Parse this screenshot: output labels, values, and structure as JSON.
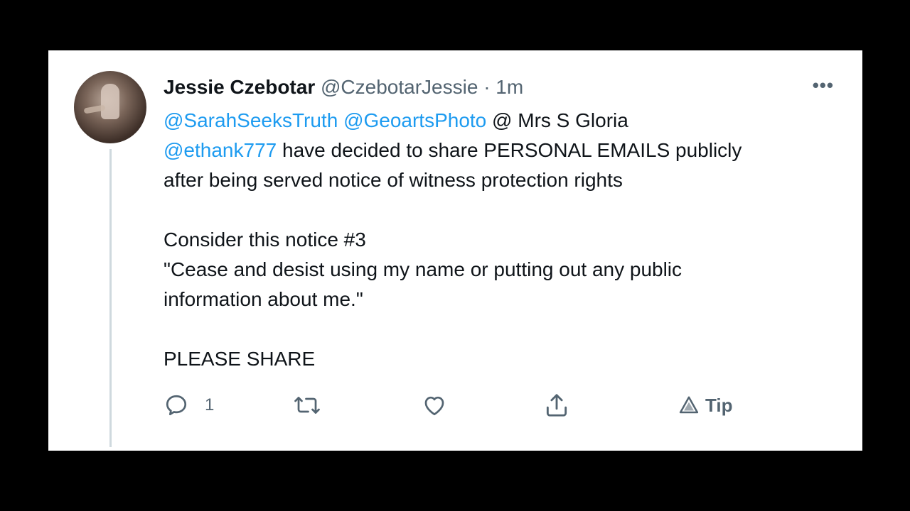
{
  "tweet": {
    "author_name": "Jessie Czebotar",
    "author_handle": "@CzebotarJessie",
    "separator": "·",
    "time": "1m",
    "more_label": "•••",
    "line1": {
      "mention1": "@SarahSeeksTruth",
      "mention2": "@GeoartsPhoto",
      "rest": " @ Mrs S Gloria"
    },
    "line2": {
      "mention": "@ethank777",
      "rest": " have decided to share PERSONAL EMAILS publicly"
    },
    "line3": "after being served notice of witness protection rights",
    "line4": "Consider this notice #3",
    "line5": "\"Cease and desist using my name or putting out any public",
    "line6": "information about me.\"",
    "line7": "PLEASE SHARE"
  },
  "actions": {
    "reply_count": "1",
    "tip_label": "Tip"
  },
  "icons": {
    "reply": "reply-icon",
    "retweet": "retweet-icon",
    "like": "heart-icon",
    "share": "share-icon",
    "tip": "tip-icon",
    "more": "more-icon"
  },
  "colors": {
    "link": "#1d9bf0",
    "text": "#0f1419",
    "muted": "#536471",
    "background": "#ffffff",
    "frame": "#000000"
  }
}
